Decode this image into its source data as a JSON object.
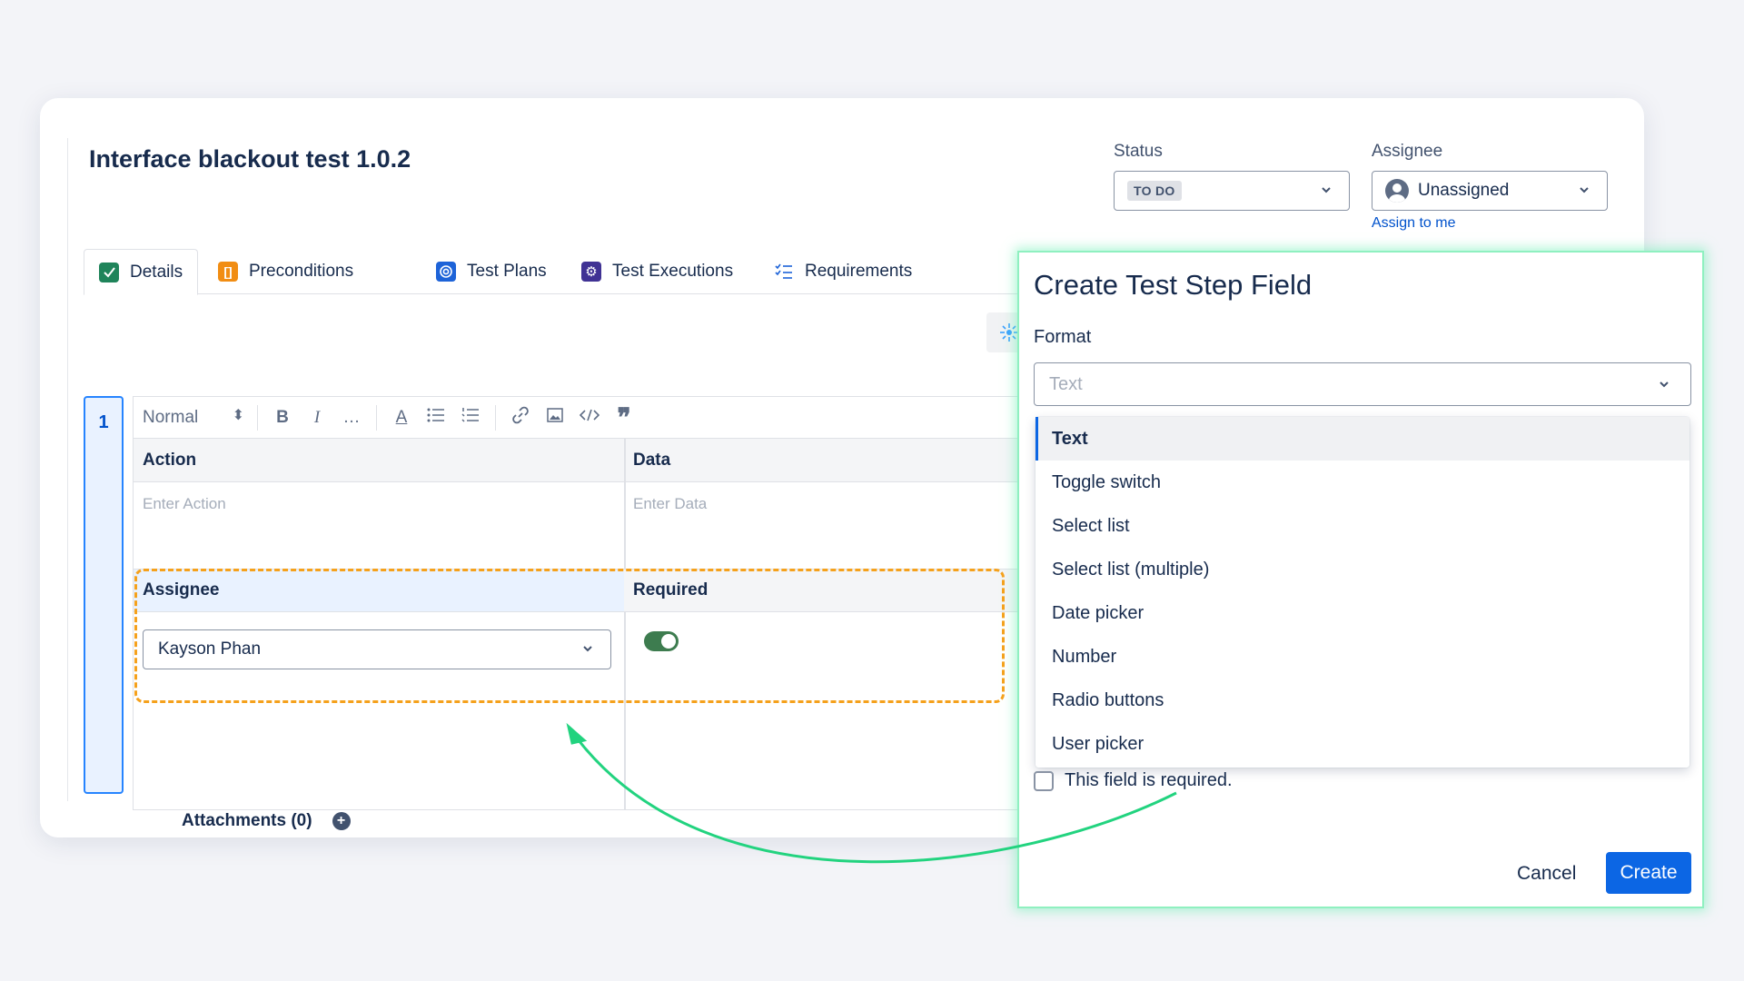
{
  "issue": {
    "title": "Interface blackout test 1.0.2"
  },
  "status": {
    "label": "Status",
    "value": "TO DO"
  },
  "assignee": {
    "label": "Assignee",
    "value": "Unassigned",
    "assign_link": "Assign to me"
  },
  "tabs": [
    {
      "label": "Details",
      "icon": "check-icon",
      "color": "#22a06b"
    },
    {
      "label": "Preconditions",
      "icon": "bracket-icon",
      "color": "#f18d13"
    },
    {
      "label": "Test Plans",
      "icon": "target-icon",
      "color": "#1d63d8"
    },
    {
      "label": "Test Executions",
      "icon": "gear-icon",
      "color": "#403294"
    },
    {
      "label": "Requirements",
      "icon": "checklist-icon",
      "color": "#1d63d8"
    }
  ],
  "step": {
    "number": "1",
    "toolbar": {
      "style": "Normal",
      "bold": "B",
      "italic": "I",
      "more": "…",
      "text_color": "A"
    },
    "columns": {
      "action": "Action",
      "data": "Data",
      "assignee": "Assignee",
      "required": "Required"
    },
    "placeholders": {
      "action": "Enter Action",
      "data": "Enter Data"
    },
    "assignee_value": "Kayson Phan",
    "required_on": true,
    "attachments": "Attachments (0)"
  },
  "dialog": {
    "title": "Create Test Step Field",
    "format_label": "Format",
    "format_placeholder": "Text",
    "options": [
      "Text",
      "Toggle switch",
      "Select list",
      "Select list (multiple)",
      "Date picker",
      "Number",
      "Radio buttons",
      "User picker"
    ],
    "selected_index": 0,
    "required_label": "This field is required.",
    "cancel": "Cancel",
    "create": "Create"
  },
  "colors": {
    "accent": "#0c66e4",
    "highlight_dash": "#f5a11c",
    "glow": "#8ff0c0",
    "arrow": "#22d37f"
  }
}
